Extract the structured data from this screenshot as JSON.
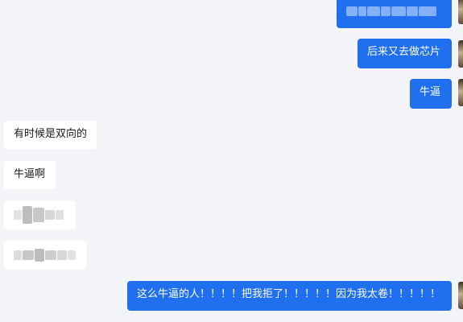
{
  "chat": {
    "messages": [
      {
        "side": "out",
        "text": "[blurred]",
        "pixelated": true
      },
      {
        "side": "out",
        "text": "后来又去做芯片"
      },
      {
        "side": "out",
        "text": "牛逼"
      },
      {
        "side": "in",
        "text": "有时候是双向的"
      },
      {
        "side": "in",
        "text": "牛逼啊"
      },
      {
        "side": "in",
        "text": "[blurred]",
        "pixelated": true
      },
      {
        "side": "in",
        "text": "[blurred]",
        "pixelated": true
      },
      {
        "side": "out",
        "text": "这么牛逼的人！！！！把我拒了！！！！！因为我太卷！！！！！"
      }
    ]
  },
  "colors": {
    "outgoing_bubble": "#1f6fef",
    "incoming_bubble": "#ffffff",
    "background": "#f3f4f7"
  }
}
